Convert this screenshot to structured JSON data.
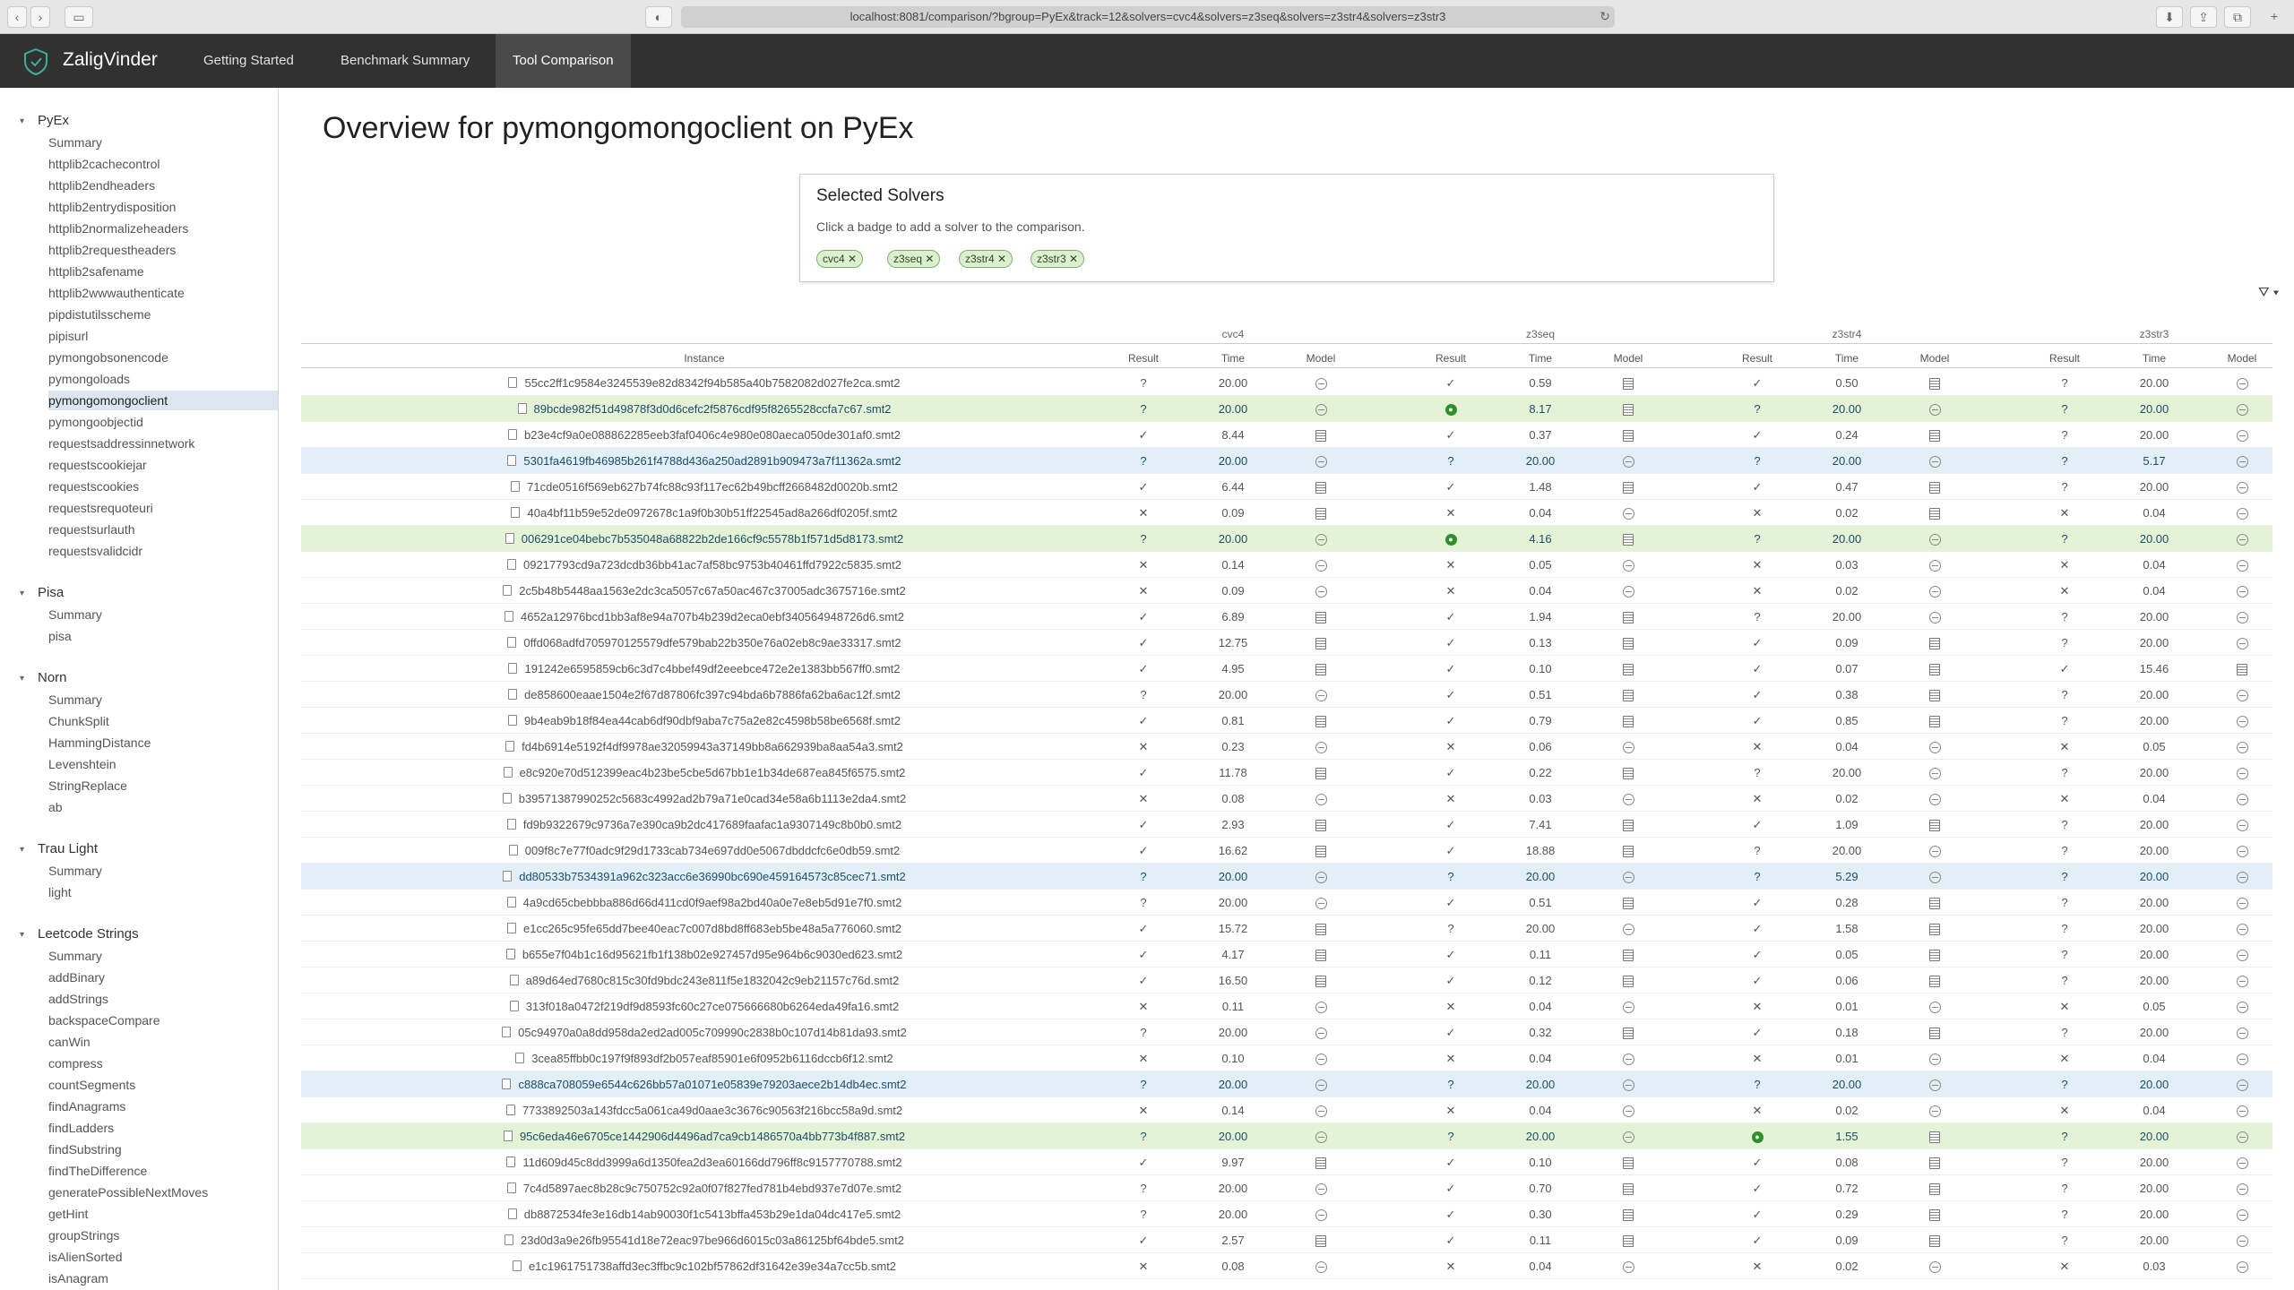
{
  "browser": {
    "url": "localhost:8081/comparison/?bgroup=PyEx&track=12&solvers=cvc4&solvers=z3seq&solvers=z3str4&solvers=z3str3",
    "back": "‹",
    "forward": "›"
  },
  "app": {
    "brand": "ZaligVinder",
    "tabs": [
      {
        "label": "Getting Started"
      },
      {
        "label": "Benchmark Summary"
      },
      {
        "label": "Tool Comparison"
      }
    ]
  },
  "sidebar": {
    "groups": [
      {
        "title": "PyEx",
        "items": [
          "Summary",
          "httplib2cachecontrol",
          "httplib2endheaders",
          "httplib2entrydisposition",
          "httplib2normalizeheaders",
          "httplib2requestheaders",
          "httplib2safename",
          "httplib2wwwauthenticate",
          "pipdistutilsscheme",
          "pipisurl",
          "pymongobsonencode",
          "pymongoloads",
          "pymongomongoclient",
          "pymongoobjectid",
          "requestsaddressinnetwork",
          "requestscookiejar",
          "requestscookies",
          "requestsrequoteuri",
          "requestsurlauth",
          "requestsvalidcidr"
        ]
      },
      {
        "title": "Pisa",
        "items": [
          "Summary",
          "pisa"
        ]
      },
      {
        "title": "Norn",
        "items": [
          "Summary",
          "ChunkSplit",
          "HammingDistance",
          "Levenshtein",
          "StringReplace",
          "ab"
        ]
      },
      {
        "title": "Trau Light",
        "items": [
          "Summary",
          "light"
        ]
      },
      {
        "title": "Leetcode Strings",
        "items": [
          "Summary",
          "addBinary",
          "addStrings",
          "backspaceCompare",
          "canWin",
          "compress",
          "countSegments",
          "findAnagrams",
          "findLadders",
          "findSubstring",
          "findTheDifference",
          "generatePossibleNextMoves",
          "getHint",
          "groupStrings",
          "isAlienSorted",
          "isAnagram"
        ]
      }
    ],
    "active": "pymongomongoclient"
  },
  "main": {
    "title": "Overview for pymongomongoclient on PyEx"
  },
  "solvers_card": {
    "title": "Selected Solvers",
    "hint": "Click a badge to add a solver to the comparison.",
    "badges": [
      "cvc4 ✕",
      "z3seq ✕",
      "z3str4 ✕",
      "z3str3 ✕"
    ]
  },
  "filter_icon": "⛛ ▾",
  "table": {
    "solvers": [
      "cvc4",
      "z3seq",
      "z3str4",
      "z3str3"
    ],
    "instance_header": "Instance",
    "subheaders": [
      "Result",
      "Time",
      "Model"
    ],
    "rows": [
      {
        "i": "55cc2ff1c9584e3245539e82d8342f94b585a40b7582082d027fe2ca.smt2",
        "hl": "",
        "c": [
          [
            "?",
            "20.00",
            "n"
          ],
          [
            "✓",
            "0.59",
            "m"
          ],
          [
            "✓",
            "0.50",
            "m"
          ],
          [
            "?",
            "20.00",
            "n"
          ]
        ]
      },
      {
        "i": "89bcde982f51d49878f3d0d6cefc2f5876cdf95f8265528ccfa7c67.smt2",
        "hl": "green",
        "c": [
          [
            "?",
            "20.00",
            "n"
          ],
          [
            "●",
            "8.17",
            "m"
          ],
          [
            "?",
            "20.00",
            "n"
          ],
          [
            "?",
            "20.00",
            "n"
          ]
        ]
      },
      {
        "i": "b23e4cf9a0e088862285eeb3faf0406c4e980e080aeca050de301af0.smt2",
        "hl": "",
        "c": [
          [
            "✓",
            "8.44",
            "m"
          ],
          [
            "✓",
            "0.37",
            "m"
          ],
          [
            "✓",
            "0.24",
            "m"
          ],
          [
            "?",
            "20.00",
            "n"
          ]
        ]
      },
      {
        "i": "5301fa4619fb46985b261f4788d436a250ad2891b909473a7f11362a.smt2",
        "hl": "blue",
        "c": [
          [
            "?",
            "20.00",
            "n"
          ],
          [
            "?",
            "20.00",
            "n"
          ],
          [
            "?",
            "20.00",
            "n"
          ],
          [
            "?",
            "5.17",
            "n"
          ]
        ]
      },
      {
        "i": "71cde0516f569eb627b74fc88c93f117ec62b49bcff2668482d0020b.smt2",
        "hl": "",
        "c": [
          [
            "✓",
            "6.44",
            "m"
          ],
          [
            "✓",
            "1.48",
            "m"
          ],
          [
            "✓",
            "0.47",
            "m"
          ],
          [
            "?",
            "20.00",
            "n"
          ]
        ]
      },
      {
        "i": "40a4bf11b59e52de0972678c1a9f0b30b51ff22545ad8a266df0205f.smt2",
        "hl": "",
        "c": [
          [
            "✕",
            "0.09",
            "m"
          ],
          [
            "✕",
            "0.04",
            "n"
          ],
          [
            "✕",
            "0.02",
            "m"
          ],
          [
            "✕",
            "0.04",
            "n"
          ]
        ]
      },
      {
        "i": "006291ce04bebc7b535048a68822b2de166cf9c5578b1f571d5d8173.smt2",
        "hl": "green",
        "c": [
          [
            "?",
            "20.00",
            "n"
          ],
          [
            "●",
            "4.16",
            "m"
          ],
          [
            "?",
            "20.00",
            "n"
          ],
          [
            "?",
            "20.00",
            "n"
          ]
        ]
      },
      {
        "i": "09217793cd9a723dcdb36bb41ac7af58bc9753b40461ffd7922c5835.smt2",
        "hl": "",
        "c": [
          [
            "✕",
            "0.14",
            "n"
          ],
          [
            "✕",
            "0.05",
            "n"
          ],
          [
            "✕",
            "0.03",
            "n"
          ],
          [
            "✕",
            "0.04",
            "n"
          ]
        ]
      },
      {
        "i": "2c5b48b5448aa1563e2dc3ca5057c67a50ac467c37005adc3675716e.smt2",
        "hl": "",
        "c": [
          [
            "✕",
            "0.09",
            "n"
          ],
          [
            "✕",
            "0.04",
            "n"
          ],
          [
            "✕",
            "0.02",
            "n"
          ],
          [
            "✕",
            "0.04",
            "n"
          ]
        ]
      },
      {
        "i": "4652a12976bcd1bb3af8e94a707b4b239d2eca0ebf340564948726d6.smt2",
        "hl": "",
        "c": [
          [
            "✓",
            "6.89",
            "m"
          ],
          [
            "✓",
            "1.94",
            "m"
          ],
          [
            "?",
            "20.00",
            "n"
          ],
          [
            "?",
            "20.00",
            "n"
          ]
        ]
      },
      {
        "i": "0ffd068adfd705970125579dfe579bab22b350e76a02eb8c9ae33317.smt2",
        "hl": "",
        "c": [
          [
            "✓",
            "12.75",
            "m"
          ],
          [
            "✓",
            "0.13",
            "m"
          ],
          [
            "✓",
            "0.09",
            "m"
          ],
          [
            "?",
            "20.00",
            "n"
          ]
        ]
      },
      {
        "i": "191242e6595859cb6c3d7c4bbef49df2eeebce472e2e1383bb567ff0.smt2",
        "hl": "",
        "c": [
          [
            "✓",
            "4.95",
            "m"
          ],
          [
            "✓",
            "0.10",
            "m"
          ],
          [
            "✓",
            "0.07",
            "m"
          ],
          [
            "✓",
            "15.46",
            "m"
          ]
        ]
      },
      {
        "i": "de858600eaae1504e2f67d87806fc397c94bda6b7886fa62ba6ac12f.smt2",
        "hl": "",
        "c": [
          [
            "?",
            "20.00",
            "n"
          ],
          [
            "✓",
            "0.51",
            "m"
          ],
          [
            "✓",
            "0.38",
            "m"
          ],
          [
            "?",
            "20.00",
            "n"
          ]
        ]
      },
      {
        "i": "9b4eab9b18f84ea44cab6df90dbf9aba7c75a2e82c4598b58be6568f.smt2",
        "hl": "",
        "c": [
          [
            "✓",
            "0.81",
            "m"
          ],
          [
            "✓",
            "0.79",
            "m"
          ],
          [
            "✓",
            "0.85",
            "m"
          ],
          [
            "?",
            "20.00",
            "n"
          ]
        ]
      },
      {
        "i": "fd4b6914e5192f4df9978ae32059943a37149bb8a662939ba8aa54a3.smt2",
        "hl": "",
        "c": [
          [
            "✕",
            "0.23",
            "n"
          ],
          [
            "✕",
            "0.06",
            "n"
          ],
          [
            "✕",
            "0.04",
            "n"
          ],
          [
            "✕",
            "0.05",
            "n"
          ]
        ]
      },
      {
        "i": "e8c920e70d512399eac4b23be5cbe5d67bb1e1b34de687ea845f6575.smt2",
        "hl": "",
        "c": [
          [
            "✓",
            "11.78",
            "m"
          ],
          [
            "✓",
            "0.22",
            "m"
          ],
          [
            "?",
            "20.00",
            "n"
          ],
          [
            "?",
            "20.00",
            "n"
          ]
        ]
      },
      {
        "i": "b39571387990252c5683c4992ad2b79a71e0cad34e58a6b1113e2da4.smt2",
        "hl": "",
        "c": [
          [
            "✕",
            "0.08",
            "n"
          ],
          [
            "✕",
            "0.03",
            "n"
          ],
          [
            "✕",
            "0.02",
            "n"
          ],
          [
            "✕",
            "0.04",
            "n"
          ]
        ]
      },
      {
        "i": "fd9b9322679c9736a7e390ca9b2dc417689faafac1a9307149c8b0b0.smt2",
        "hl": "",
        "c": [
          [
            "✓",
            "2.93",
            "m"
          ],
          [
            "✓",
            "7.41",
            "m"
          ],
          [
            "✓",
            "1.09",
            "m"
          ],
          [
            "?",
            "20.00",
            "n"
          ]
        ]
      },
      {
        "i": "009f8c7e77f0adc9f29d1733cab734e697dd0e5067dbddcfc6e0db59.smt2",
        "hl": "",
        "c": [
          [
            "✓",
            "16.62",
            "m"
          ],
          [
            "✓",
            "18.88",
            "m"
          ],
          [
            "?",
            "20.00",
            "n"
          ],
          [
            "?",
            "20.00",
            "n"
          ]
        ]
      },
      {
        "i": "dd80533b7534391a962c323acc6e36990bc690e459164573c85cec71.smt2",
        "hl": "blue",
        "c": [
          [
            "?",
            "20.00",
            "n"
          ],
          [
            "?",
            "20.00",
            "n"
          ],
          [
            "?",
            "5.29",
            "n"
          ],
          [
            "?",
            "20.00",
            "n"
          ]
        ]
      },
      {
        "i": "4a9cd65cbebbba886d66d411cd0f9aef98a2bd40a0e7e8eb5d91e7f0.smt2",
        "hl": "",
        "c": [
          [
            "?",
            "20.00",
            "n"
          ],
          [
            "✓",
            "0.51",
            "m"
          ],
          [
            "✓",
            "0.28",
            "m"
          ],
          [
            "?",
            "20.00",
            "n"
          ]
        ]
      },
      {
        "i": "e1cc265c95fe65dd7bee40eac7c007d8bd8ff683eb5be48a5a776060.smt2",
        "hl": "",
        "c": [
          [
            "✓",
            "15.72",
            "m"
          ],
          [
            "?",
            "20.00",
            "n"
          ],
          [
            "✓",
            "1.58",
            "m"
          ],
          [
            "?",
            "20.00",
            "n"
          ]
        ]
      },
      {
        "i": "b655e7f04b1c16d95621fb1f138b02e927457d95e964b6c9030ed623.smt2",
        "hl": "",
        "c": [
          [
            "✓",
            "4.17",
            "m"
          ],
          [
            "✓",
            "0.11",
            "m"
          ],
          [
            "✓",
            "0.05",
            "m"
          ],
          [
            "?",
            "20.00",
            "n"
          ]
        ]
      },
      {
        "i": "a89d64ed7680c815c30fd9bdc243e811f5e1832042c9eb21157c76d.smt2",
        "hl": "",
        "c": [
          [
            "✓",
            "16.50",
            "m"
          ],
          [
            "✓",
            "0.12",
            "m"
          ],
          [
            "✓",
            "0.06",
            "m"
          ],
          [
            "?",
            "20.00",
            "n"
          ]
        ]
      },
      {
        "i": "313f018a0472f219df9d8593fc60c27ce075666680b6264eda49fa16.smt2",
        "hl": "",
        "c": [
          [
            "✕",
            "0.11",
            "n"
          ],
          [
            "✕",
            "0.04",
            "n"
          ],
          [
            "✕",
            "0.01",
            "n"
          ],
          [
            "✕",
            "0.05",
            "n"
          ]
        ]
      },
      {
        "i": "05c94970a0a8dd958da2ed2ad005c709990c2838b0c107d14b81da93.smt2",
        "hl": "",
        "c": [
          [
            "?",
            "20.00",
            "n"
          ],
          [
            "✓",
            "0.32",
            "m"
          ],
          [
            "✓",
            "0.18",
            "m"
          ],
          [
            "?",
            "20.00",
            "n"
          ]
        ]
      },
      {
        "i": "3cea85ffbb0c197f9f893df2b057eaf85901e6f0952b6116dccb6f12.smt2",
        "hl": "",
        "c": [
          [
            "✕",
            "0.10",
            "n"
          ],
          [
            "✕",
            "0.04",
            "n"
          ],
          [
            "✕",
            "0.01",
            "n"
          ],
          [
            "✕",
            "0.04",
            "n"
          ]
        ]
      },
      {
        "i": "c888ca708059e6544c626bb57a01071e05839e79203aece2b14db4ec.smt2",
        "hl": "blue",
        "c": [
          [
            "?",
            "20.00",
            "n"
          ],
          [
            "?",
            "20.00",
            "n"
          ],
          [
            "?",
            "20.00",
            "n"
          ],
          [
            "?",
            "20.00",
            "n"
          ]
        ]
      },
      {
        "i": "7733892503a143fdcc5a061ca49d0aae3c3676c90563f216bcc58a9d.smt2",
        "hl": "",
        "c": [
          [
            "✕",
            "0.14",
            "n"
          ],
          [
            "✕",
            "0.04",
            "n"
          ],
          [
            "✕",
            "0.02",
            "n"
          ],
          [
            "✕",
            "0.04",
            "n"
          ]
        ]
      },
      {
        "i": "95c6eda46e6705ce1442906d4496ad7ca9cb1486570a4bb773b4f887.smt2",
        "hl": "green",
        "c": [
          [
            "?",
            "20.00",
            "n"
          ],
          [
            "?",
            "20.00",
            "n"
          ],
          [
            "●",
            "1.55",
            "m"
          ],
          [
            "?",
            "20.00",
            "n"
          ]
        ]
      },
      {
        "i": "11d609d45c8dd3999a6d1350fea2d3ea60166dd796ff8c9157770788.smt2",
        "hl": "",
        "c": [
          [
            "✓",
            "9.97",
            "m"
          ],
          [
            "✓",
            "0.10",
            "m"
          ],
          [
            "✓",
            "0.08",
            "m"
          ],
          [
            "?",
            "20.00",
            "n"
          ]
        ]
      },
      {
        "i": "7c4d5897aec8b28c9c750752c92a0f07f827fed781b4ebd937e7d07e.smt2",
        "hl": "",
        "c": [
          [
            "?",
            "20.00",
            "n"
          ],
          [
            "✓",
            "0.70",
            "m"
          ],
          [
            "✓",
            "0.72",
            "m"
          ],
          [
            "?",
            "20.00",
            "n"
          ]
        ]
      },
      {
        "i": "db8872534fe3e16db14ab90030f1c5413bffa453b29e1da04dc417e5.smt2",
        "hl": "",
        "c": [
          [
            "?",
            "20.00",
            "n"
          ],
          [
            "✓",
            "0.30",
            "m"
          ],
          [
            "✓",
            "0.29",
            "m"
          ],
          [
            "?",
            "20.00",
            "n"
          ]
        ]
      },
      {
        "i": "23d0d3a9e26fb95541d18e72eac97be966d6015c03a86125bf64bde5.smt2",
        "hl": "",
        "c": [
          [
            "✓",
            "2.57",
            "m"
          ],
          [
            "✓",
            "0.11",
            "m"
          ],
          [
            "✓",
            "0.09",
            "m"
          ],
          [
            "?",
            "20.00",
            "n"
          ]
        ]
      },
      {
        "i": "e1c1961751738affd3ec3ffbc9c102bf57862df31642e39e34a7cc5b.smt2",
        "hl": "",
        "c": [
          [
            "✕",
            "0.08",
            "n"
          ],
          [
            "✕",
            "0.04",
            "n"
          ],
          [
            "✕",
            "0.02",
            "n"
          ],
          [
            "✕",
            "0.03",
            "n"
          ]
        ]
      }
    ]
  }
}
